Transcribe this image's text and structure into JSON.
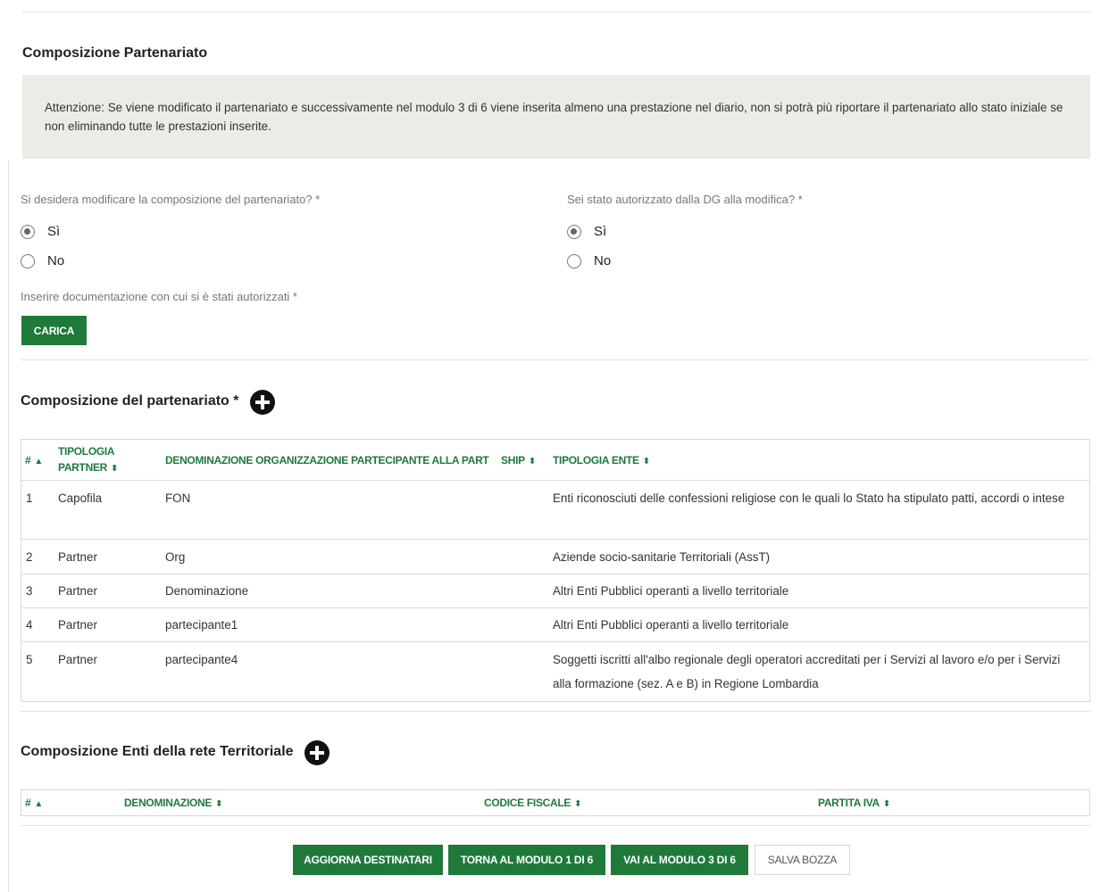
{
  "section_title": "Composizione Partenariato",
  "alert_text": "Attenzione: Se viene modificato il partenariato e successivamente nel modulo 3 di 6 viene inserita almeno una prestazione nel diario, non si potrà più riportare il partenariato allo stato iniziale se non eliminando tutte le prestazioni inserite.",
  "question_modify": {
    "label": "Si desidera modificare la composizione del partenariato? *",
    "options": [
      {
        "label": "Sì",
        "checked": true
      },
      {
        "label": "No",
        "checked": false
      }
    ]
  },
  "question_authorized": {
    "label": "Sei stato autorizzato dalla DG alla modifica? *",
    "options": [
      {
        "label": "Sì",
        "checked": true
      },
      {
        "label": "No",
        "checked": false
      }
    ]
  },
  "upload": {
    "label": "Inserire documentazione con cui si è stati autorizzati *",
    "button": "CARICA"
  },
  "partnership": {
    "title": "Composizione del partenariato *",
    "headers": {
      "num": "#",
      "tipologia_partner_1": "TIPOLOGIA",
      "tipologia_partner_2": "PARTNER",
      "denominazione": "DENOMINAZIONE ORGANIZZAZIONE PARTECIPANTE ALLA PART",
      "ship": "SHIP",
      "tipologia_ente": "TIPOLOGIA ENTE"
    },
    "rows": [
      {
        "num": "1",
        "tipo": "Capofila",
        "den": "FON",
        "ente": "Enti riconosciuti delle confessioni religiose con le quali lo Stato ha stipulato patti, accordi o intese",
        "ente2": ""
      },
      {
        "num": "2",
        "tipo": "Partner",
        "den": "Org",
        "ente": "Aziende socio-sanitarie Territoriali (AssT)",
        "ente2": ""
      },
      {
        "num": "3",
        "tipo": "Partner",
        "den": "Denominazione",
        "ente": "Altri Enti Pubblici operanti a livello territoriale",
        "ente2": ""
      },
      {
        "num": "4",
        "tipo": "Partner",
        "den": "partecipante1",
        "ente": "Altri Enti Pubblici operanti a livello territoriale",
        "ente2": ""
      },
      {
        "num": "5",
        "tipo": "Partner",
        "den": "partecipante4",
        "ente": "Soggetti iscritti all'albo regionale degli operatori accreditati per i Servizi al lavoro e/o per i Servizi",
        "ente2": "alla formazione (sez. A e B) in Regione Lombardia"
      }
    ]
  },
  "network": {
    "title": "Composizione Enti della rete Territoriale",
    "headers": {
      "num": "#",
      "denominazione": "DENOMINAZIONE",
      "codice_fiscale": "CODICE FISCALE",
      "partita_iva": "PARTITA IVA"
    }
  },
  "footer_buttons": {
    "aggiorna": "AGGIORNA DESTINATARI",
    "torna": "TORNA AL MODULO 1 DI 6",
    "vai": "VAI AL MODULO 3 DI 6",
    "salva": "SALVA BOZZA"
  },
  "colors": {
    "accent": "#1f7a3a",
    "alert_bg": "#ecebe6"
  }
}
